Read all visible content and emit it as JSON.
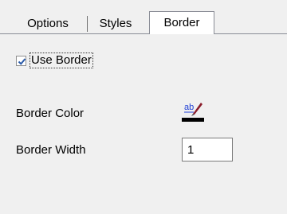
{
  "tabs": {
    "options_label": "Options",
    "styles_label": "Styles",
    "border_label": "Border",
    "active": "Border"
  },
  "border_panel": {
    "use_border": {
      "label": "Use Border",
      "checked": true
    },
    "border_color": {
      "label": "Border Color",
      "icon": "spell-check-color-icon",
      "swatch_color": "#000000"
    },
    "border_width": {
      "label": "Border Width",
      "value": "1"
    }
  },
  "colors": {
    "background": "#f0f0f0",
    "checkmark": "#2a5aa8",
    "icon_underline": "#1f3fd6",
    "pencil": "#8a1c2a"
  }
}
